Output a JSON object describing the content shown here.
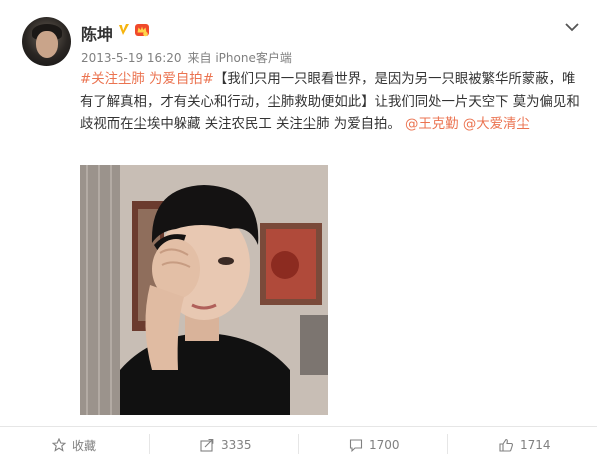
{
  "post": {
    "username": "陈坤",
    "timestamp": "2013-5-19 16:20",
    "source": "来自 iPhone客户端",
    "text_segments": [
      {
        "type": "link",
        "text": "#关注尘肺 为爱自拍#"
      },
      {
        "type": "text",
        "text": "【我们只用一只眼看世界，是因为另一只眼被繁华所蒙蔽，唯有了解真相，才有关心和行动，尘肺救助便如此】让我们同处一片天空下 莫为偏见和歧视而在尘埃中躲藏 关注农民工 关注尘肺 为爱自拍。 "
      },
      {
        "type": "link",
        "text": "@王克勤"
      },
      {
        "type": "text",
        "text": " "
      },
      {
        "type": "link",
        "text": "@大爱清尘"
      }
    ]
  },
  "actions": {
    "favorite_label": "收藏",
    "repost_count": "3335",
    "comment_count": "1700",
    "like_count": "1714"
  },
  "icons": {
    "verified": "verified-v-icon",
    "member": "member-crown-icon",
    "menu": "chevron-down-icon",
    "favorite": "star-icon",
    "repost": "share-arrow-icon",
    "comment": "speech-bubble-icon",
    "like": "thumbs-up-icon"
  },
  "colors": {
    "link": "#eb7350",
    "verified": "#f6b40e",
    "meta": "#808080"
  }
}
